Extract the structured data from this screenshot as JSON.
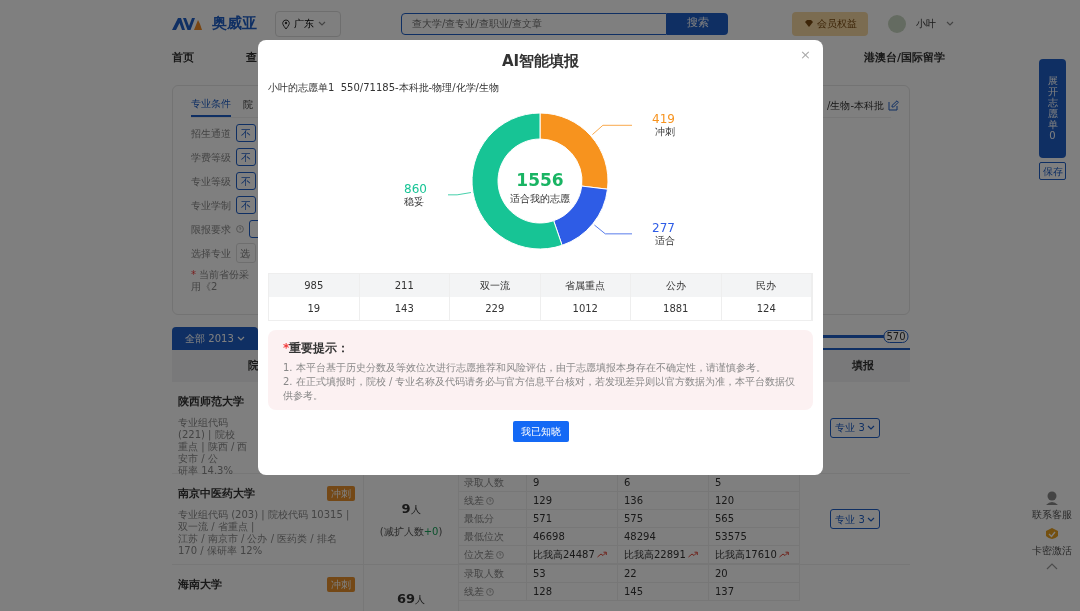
{
  "header": {
    "logo_text": "奥威亚",
    "location": "广东",
    "search_placeholder": "查大学/查专业/查职业/查文章",
    "search_button": "搜索",
    "member_button": "会员权益",
    "user_name": "小叶"
  },
  "nav": {
    "items": [
      {
        "label": "首页"
      },
      {
        "label": "查"
      }
    ],
    "right_item": "港澳台/国际留学"
  },
  "filters": {
    "tabs": [
      {
        "label": "专业条件",
        "selected": true
      },
      {
        "label": "院",
        "selected": false
      }
    ],
    "rows": [
      {
        "label": "招生通道",
        "kind": "button",
        "value": "不",
        "help": false
      },
      {
        "label": "学费等级",
        "kind": "button",
        "value": "不",
        "help": false
      },
      {
        "label": "专业等级",
        "kind": "button",
        "value": "不",
        "help": false
      },
      {
        "label": "专业学制",
        "kind": "button",
        "value": "不",
        "help": false
      },
      {
        "label": "限报要求",
        "kind": "button",
        "value": "",
        "help": true
      },
      {
        "label": "选择专业",
        "kind": "field",
        "placeholder": "选",
        "help": false
      }
    ],
    "note_mark": "*",
    "note": "当前省份采用《2",
    "profile_tail": "/生物-本科批"
  },
  "list": {
    "tabs": [
      {
        "label": "全部 2013",
        "selected": true
      }
    ],
    "slider": {
      "level": 1,
      "reading": "570"
    },
    "columns": [
      "院",
      "填报"
    ]
  },
  "schools": [
    {
      "name": "陕西师范大学",
      "details": [
        "专业组代码 (221) | 院校",
        "重点 | 陕西 / 西安市 / 公",
        "研率 14.3%"
      ],
      "major_button": "专业 3"
    },
    {
      "name": "南京中医药大学",
      "tag": "冲刺",
      "details": [
        "专业组代码 (203) | 院校代码 10315 | 双一流 / 省重点 |",
        "江苏 / 南京市 / 公办 / 医药类 / 排名 170 / 保研率 12%"
      ],
      "count": "9",
      "count_unit": "人",
      "change_prefix": "(减扩人数",
      "change_value": "+0",
      "change_suffix": ")",
      "major_button": "专业 3",
      "stats": [
        {
          "label": "录取人数",
          "help": false,
          "kind": "plain",
          "values": [
            "9",
            "6",
            "5"
          ]
        },
        {
          "label": "线差",
          "help": true,
          "kind": "plain",
          "values": [
            "129",
            "136",
            "120"
          ]
        },
        {
          "label": "最低分",
          "help": false,
          "kind": "plain",
          "values": [
            "571",
            "575",
            "565"
          ]
        },
        {
          "label": "最低位次",
          "help": false,
          "kind": "plain",
          "values": [
            "46698",
            "48294",
            "53575"
          ]
        },
        {
          "label": "位次差",
          "help": true,
          "kind": "trend",
          "values": [
            "比我高24487",
            "比我高22891",
            "比我高17610"
          ]
        }
      ]
    },
    {
      "name": "海南大学",
      "tag": "冲刺",
      "count": "69",
      "count_unit": "人",
      "stats": [
        {
          "label": "录取人数",
          "help": false,
          "kind": "plain",
          "values": [
            "53",
            "22",
            "20"
          ]
        },
        {
          "label": "线差",
          "help": true,
          "kind": "plain",
          "values": [
            "128",
            "145",
            "137"
          ]
        }
      ]
    }
  ],
  "side": {
    "expand_button": "展开志愿单0",
    "save_button": "保存",
    "tools": [
      {
        "kind": "service",
        "label": "联系客服"
      },
      {
        "kind": "activate",
        "label": "卡密激活"
      }
    ]
  },
  "modal": {
    "title": "AI智能填报",
    "close": "×",
    "subtitle": "小叶的志愿单1  550/71185-本科批-物理/化学/生物",
    "chart": {
      "total": "1556",
      "center_label": "适合我的志愿",
      "segments": [
        {
          "color": "#f7931e"
        },
        {
          "color": "#2e5ce6"
        },
        {
          "color": "#17c495"
        }
      ],
      "chart_data": {
        "type": "donut",
        "categories": [
          "冲刺",
          "适合",
          "稳妥"
        ],
        "values": [
          419,
          277,
          860
        ],
        "data_labels": true
      }
    },
    "stats": {
      "columns": [
        "985",
        "211",
        "双一流",
        "省属重点",
        "公办",
        "民办"
      ],
      "values": [
        "19",
        "143",
        "229",
        "1012",
        "1881",
        "124"
      ]
    },
    "notice": {
      "mark": "*",
      "title": "重要提示：",
      "lines": [
        "1. 本平台基于历史分数及等效位次进行志愿推荐和风险评估，由于志愿填报本身存在不确定性，请谨慎参考。",
        "2. 在正式填报时，院校 / 专业名称及代码请务必与官方信息平台核对，若发现差异则以官方数据为准，本平台数据仅供参考。"
      ]
    },
    "confirm_button": "我已知晓"
  }
}
